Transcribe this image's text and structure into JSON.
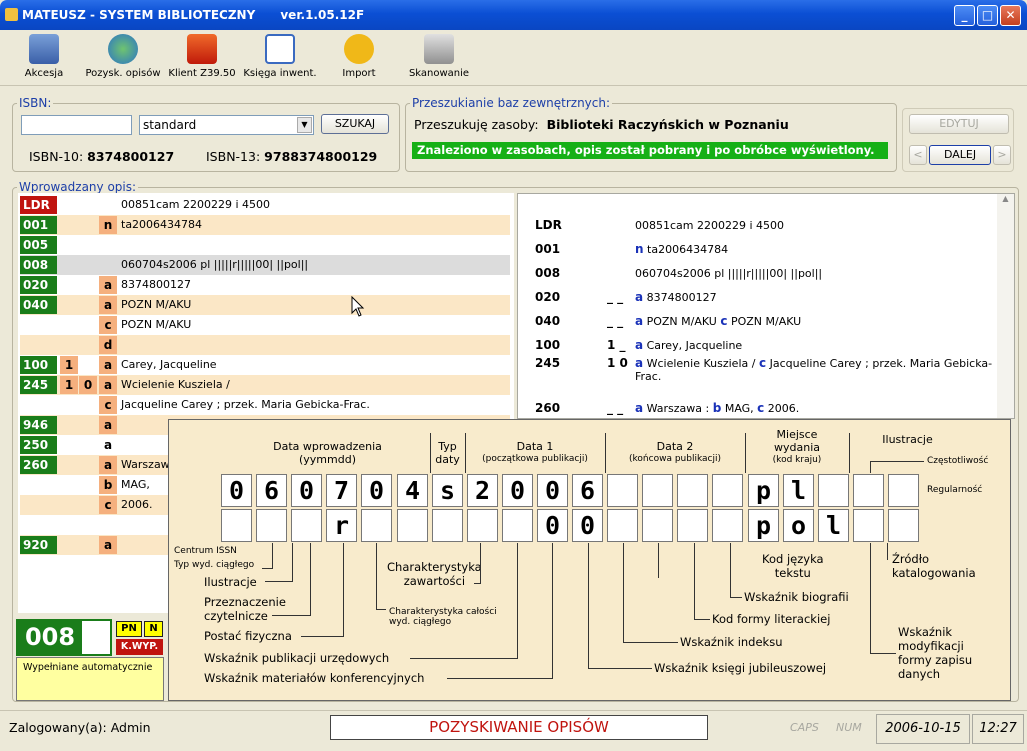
{
  "window": {
    "title": "MATEUSZ - SYSTEM BIBLIOTECZNY",
    "version": "ver.1.05.12F"
  },
  "toolbar": [
    "Akcesja",
    "Pozysk. opisów",
    "Klient Z39.50",
    "Księga inwent.",
    "Import",
    "Skanowanie"
  ],
  "isbn": {
    "legend": "ISBN:",
    "input": "",
    "select": "standard",
    "search": "SZUKAJ",
    "isbn10_label": "ISBN-10:",
    "isbn10": "8374800127",
    "isbn13_label": "ISBN-13:",
    "isbn13": "9788374800129"
  },
  "ext": {
    "legend": "Przeszukianie baz zewnętrznych:",
    "prefix": "Przeszukuję zasoby:",
    "name": "Biblioteki Raczyńskich w Poznaniu",
    "status": "Znaleziono w zasobach, opis został pobrany i po obróbce wyświetlony.",
    "edit": "EDYTUJ",
    "prev": "<",
    "next": "DALEJ",
    "nextarrow": ">"
  },
  "desc_legend": "Wprowadzany opis:",
  "marc": [
    {
      "tag": "LDR",
      "i1": "",
      "i2": "",
      "sf": "",
      "val": "00851cam  2200229 i 4500"
    },
    {
      "tag": "001",
      "i1": "",
      "i2": "",
      "sf": "n",
      "val": "ta2006434784"
    },
    {
      "tag": "005",
      "i1": "",
      "i2": "",
      "sf": "",
      "val": ""
    },
    {
      "tag": "008",
      "i1": "",
      "i2": "",
      "sf": "",
      "val": "060704s2006    pl |||||r|||||00| ||pol||"
    },
    {
      "tag": "020",
      "i1": "",
      "i2": "",
      "sf": "a",
      "val": "8374800127"
    },
    {
      "tag": "040",
      "i1": "",
      "i2": "",
      "sf": "a",
      "val": "POZN M/AKU"
    },
    {
      "tag": "",
      "i1": "",
      "i2": "",
      "sf": "c",
      "val": "POZN M/AKU"
    },
    {
      "tag": "",
      "i1": "",
      "i2": "",
      "sf": "d",
      "val": ""
    },
    {
      "tag": "100",
      "i1": "1",
      "i2": "",
      "sf": "a",
      "val": "Carey, Jacqueline"
    },
    {
      "tag": "245",
      "i1": "1",
      "i2": "0",
      "sf": "a",
      "val": "Wcielenie Kusziela /"
    },
    {
      "tag": "",
      "i1": "",
      "i2": "",
      "sf": "c",
      "val": "Jacqueline Carey ; przek. Maria Gebicka-Frac."
    },
    {
      "tag": "946",
      "i1": "",
      "i2": "",
      "sf": "a",
      "val": ""
    },
    {
      "tag": "250",
      "i1": "",
      "i2": "",
      "sf": "a",
      "val": ""
    },
    {
      "tag": "260",
      "i1": "",
      "i2": "",
      "sf": "a",
      "val": "Warszaw"
    },
    {
      "tag": "",
      "i1": "",
      "i2": "",
      "sf": "b",
      "val": "MAG,"
    },
    {
      "tag": "",
      "i1": "",
      "i2": "",
      "sf": "c",
      "val": "2006."
    },
    {
      "tag": "",
      "i1": "",
      "i2": "",
      "sf": "",
      "val": ""
    },
    {
      "tag": "920",
      "i1": "",
      "i2": "",
      "sf": "a",
      "val": ""
    }
  ],
  "preview": [
    {
      "tag": "LDR",
      "ind": "",
      "text": "00851cam 2200229 i 4500"
    },
    {
      "tag": "001",
      "ind": "",
      "text": "ta2006434784",
      "code": "n"
    },
    {
      "tag": "008",
      "ind": "",
      "text": "060704s2006 pl |||||r|||||00| ||pol||"
    },
    {
      "tag": "020",
      "ind": "_ _",
      "code": "a",
      "text": "8374800127"
    },
    {
      "tag": "040",
      "ind": "_ _",
      "code": "a",
      "text": "POZN M/AKU",
      "code2": "c",
      "text2": "POZN M/AKU"
    },
    {
      "tag": "100",
      "ind": "1 _",
      "code": "a",
      "text": "Carey, Jacqueline"
    },
    {
      "tag": "245",
      "ind": "1 0",
      "code": "a",
      "text": "Wcielenie Kusziela /",
      "code2": "c",
      "text2": "Jacqueline Carey ; przek. Maria Gebicka-",
      "line2": "Frac."
    },
    {
      "tag": "260",
      "ind": "_ _",
      "code": "a",
      "text": "Warszawa :",
      "code2": "b",
      "text2": "MAG,",
      "code3": "c",
      "text3": "2006."
    }
  ],
  "bottom": {
    "tag": "008",
    "pn": "PN",
    "n": "N",
    "kwyp": "K.WYP.",
    "auto": "Wypełniane automatycznie"
  },
  "ov": {
    "h_data": "Data wprowadzenia",
    "h_data_sub": "(yymmdd)",
    "h_typ": "Typ",
    "h_typ2": "daty",
    "h_d1": "Data 1",
    "h_d1_sub": "(początkowa publikacji)",
    "h_d2": "Data 2",
    "h_d2_sub": "(końcowa publikacji)",
    "h_mw": "Miejsce",
    "h_mw2": "wydania",
    "h_mw_sub": "(kod kraju)",
    "h_il": "Ilustracje",
    "czest": "Częstotliwość",
    "regul": "Regularność",
    "row1": [
      "0",
      "6",
      "0",
      "7",
      "0",
      "4",
      "s",
      "2",
      "0",
      "0",
      "6",
      "",
      "",
      "",
      "",
      "p",
      "l",
      "",
      "",
      ""
    ],
    "row2": [
      "",
      "",
      "",
      "r",
      "",
      "",
      "",
      "",
      "",
      "0",
      "0",
      "",
      "",
      "",
      "",
      "p",
      "o",
      "l",
      "",
      ""
    ],
    "centrum": "Centrum ISSN",
    "typwyd": "Typ wyd. ciągłego",
    "ilustr": "Ilustracje",
    "przezn": "Przeznaczenie",
    "przezn2": "czytelnicze",
    "postac": "Postać fizyczna",
    "char_cal": "Charakterystyka całości",
    "char_cal2": "wyd. ciągłego",
    "char_zaw": "Charakterystyka",
    "char_zaw2": "zawartości",
    "wpu": "Wskaźnik publikacji urzędowych",
    "wmk": "Wskaźnik materiałów konferencyjnych",
    "wkj": "Wskaźnik księgi jubileuszowej",
    "wi": "Wskaźnik indeksu",
    "kfl": "Kod formy literackiej",
    "wb": "Wskaźnik biografii",
    "kj": "Kod języka",
    "kj2": "tekstu",
    "zk": "Źródło",
    "zk2": "katalogowania",
    "wm": "Wskaźnik",
    "wm2": "modyfikacji",
    "wm3": "formy zapisu",
    "wm4": "danych"
  },
  "status": {
    "user": "Zalogowany(a): Admin",
    "mode": "POZYSKIWANIE OPISÓW",
    "caps": "CAPS",
    "num": "NUM",
    "date": "2006-10-15",
    "time": "12:27"
  }
}
